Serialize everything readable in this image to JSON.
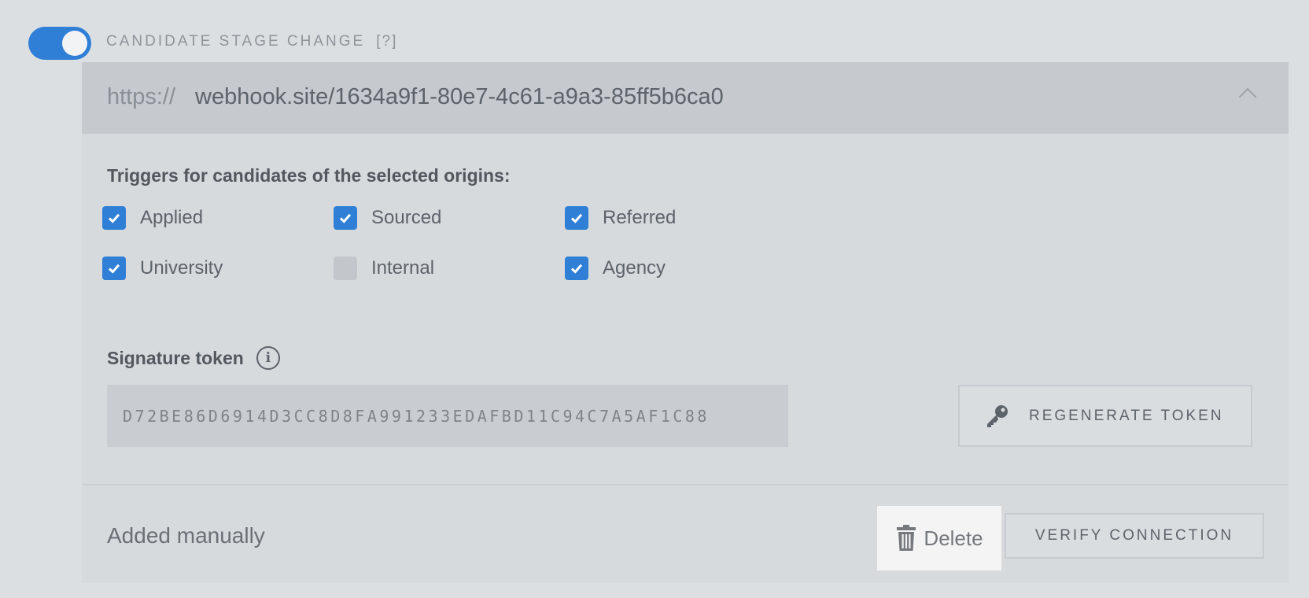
{
  "webhook": {
    "enabled": true,
    "title": "CANDIDATE STAGE CHANGE",
    "help_marker": "[?]",
    "url_protocol": "https://",
    "url_host": "webhook.site/1634a9f1-80e7-4c61-a9a3-85ff5b6ca0",
    "expanded": true
  },
  "triggers": {
    "label": "Triggers for candidates of the selected origins:",
    "origins": [
      {
        "label": "Applied",
        "checked": true
      },
      {
        "label": "Sourced",
        "checked": true
      },
      {
        "label": "Referred",
        "checked": true
      },
      {
        "label": "University",
        "checked": true
      },
      {
        "label": "Internal",
        "checked": false
      },
      {
        "label": "Agency",
        "checked": true
      }
    ]
  },
  "signature": {
    "label": "Signature token",
    "token": "D72BE86D6914D3CC8D8FA991233EDAFBD11C94C7A5AF1C88",
    "regenerate_label": "REGENERATE TOKEN",
    "icons": {
      "info": "info-icon",
      "key": "key-icon"
    }
  },
  "footer": {
    "source_note": "Added manually",
    "delete_label": "Delete",
    "verify_label": "VERIFY CONNECTION",
    "icons": {
      "delete": "trash-icon"
    }
  },
  "colors": {
    "accent": "#2f7fd6",
    "background": "#dcdfe2",
    "url_bar": "#c6c9cd"
  }
}
